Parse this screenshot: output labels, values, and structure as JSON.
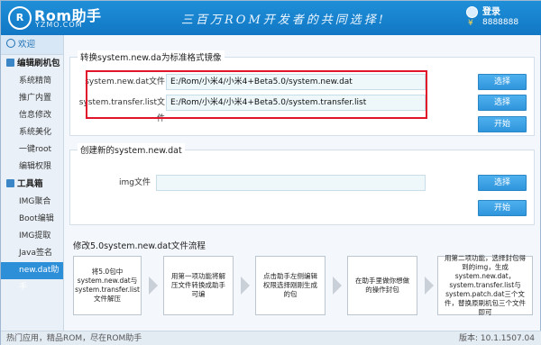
{
  "app": {
    "logo_mark": "R",
    "logo_name": "Rom助手",
    "logo_domain": "YZMO.COM",
    "slogan": "三百万ROM开发者的共同选择!"
  },
  "user": {
    "login_label": "登录",
    "coins": "8888888"
  },
  "sidebar": {
    "home": "欢迎",
    "groups": [
      {
        "label": "编辑刷机包",
        "items": [
          "系统精简",
          "推广内置",
          "信息修改",
          "系统美化",
          "一键root",
          "编辑权限"
        ]
      },
      {
        "label": "工具箱",
        "items": [
          "IMG聚合",
          "Boot编辑",
          "IMG提取",
          "Java签名",
          "new.dat助手"
        ]
      }
    ],
    "active_item": "new.dat助手"
  },
  "convert_panel": {
    "title": "转换system.new.da为标准格式镜像",
    "row1_label": "system.new.dat文件",
    "row1_value": "E:/Rom/小米4/小米4+Beta5.0/system.new.dat",
    "row2_label": "system.transfer.list文件",
    "row2_value": "E:/Rom/小米4/小米4+Beta5.0/system.transfer.list",
    "select_label": "选择",
    "start_label": "开始"
  },
  "create_panel": {
    "title": "创建新的system.new.dat",
    "img_label": "img文件",
    "img_value": "",
    "select_label": "选择",
    "start_label": "开始"
  },
  "flow": {
    "title": "修改5.0system.new.dat文件流程",
    "steps": [
      "将5.0包中system.new.dat与system.transfer.list文件解压",
      "用第一项功能将解压文件转换成助手可编",
      "点击助手左侧编辑权限选择刚刚生成的包",
      "在助手里做你想做的操作封包",
      "用第二项功能，选择封包得到的img，生成 system.new.dat，system.transfer.list与system.patch.dat三个文件，替换原刷机包三个文件即可"
    ]
  },
  "status": {
    "left": "热门应用，精品ROM，尽在ROM助手",
    "version": "版本: 10.1.1507.04"
  }
}
